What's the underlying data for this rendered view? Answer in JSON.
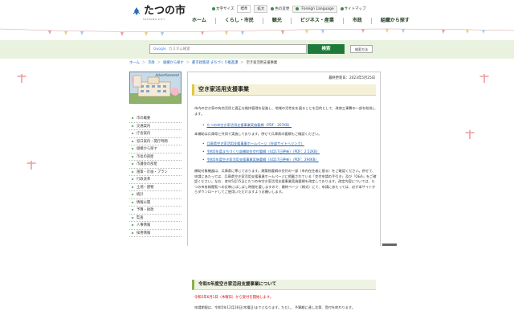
{
  "header": {
    "logo_name": "たつの市",
    "logo_sub": "TATSUNO CITY",
    "utility": {
      "font_size_label": "文字サイズ",
      "font_sizes": [
        "標準",
        "拡大"
      ],
      "lang_label": "Foreign Language",
      "sitemap_label": "サイトマップ",
      "color_label": "色の変更"
    },
    "nav": [
      "ホーム",
      "くらし・市民",
      "観光",
      "ビジネス・産業",
      "市政",
      "組織から探す"
    ]
  },
  "search": {
    "google_label": "Google",
    "placeholder": "カスタム検索",
    "button_label": "検索",
    "detail_label": "検索方法"
  },
  "breadcrumb": [
    "ホーム",
    "市政",
    "組織から探す",
    "都市政策部 まちづくり推進課",
    "空き家活用支援事業"
  ],
  "sidebar": {
    "banner_label": "Advertisement",
    "items": [
      "市の概要",
      "交通案内",
      "庁舎案内",
      "窓口案内・開庁時間",
      "組織から探す",
      "市長の部屋",
      "市議会の部屋",
      "施策・計画・プラン",
      "行政改革",
      "土地・建物",
      "統計",
      "情報公開",
      "予算・財政",
      "監査",
      "人事情報",
      "採用情報"
    ]
  },
  "main": {
    "updated": "最終更新日：2023年5月25日",
    "title": "空き家活用支援事業",
    "intro": "市内の空き家の有効活用と適正な維持管理を促進し、地域の活性化を図ることを目的として、改修工事費の一部を助成します。",
    "links1": [
      "たつの市空き家活用支援事業実施要綱（PDF：207KB）"
    ],
    "note1": "本補助は兵庫県と共同で実施しております。併せて兵庫県の要綱もご確認ください。",
    "links2": [
      "兵庫県空き家活用支援事業ホームページ（外部サイトへリンク）",
      "令和5年度まちづくり部補助金交付要綱（4月17日更新）（PDF：2.52KB）",
      "令和5年度空き家活用支援事業実施要綱（4月17日更新）（PDF：294KB）"
    ],
    "body2": "補助対象機器は、兵庫県に準じております。建築物要綱の交付の一部（市内在住者に限る）をご確認ください。併せて、申請にあたっては、兵庫県空き家活用支援事業ホームページに掲載されている「交付申請の手引き」及び「Q&A」をご確認ください。なお、本年5月15日にたつの市空き家活用支援事業実施要綱を改定しております。改定内容については、たつの市各検閲覧への反映にはしばし時間を要しますので、最終ページ（様式）にて、申請にあたっては、必ず本サイトからダウンロードしてご使用いただけますようお願いします。",
    "section_title": "令和5年度空き家活用支援事業について",
    "red_text": "令和5年6月1日（木曜日）から受付を開始します。",
    "footer_text": "申請期限は、令和5年12月28日(木曜日)までとなります。ただし、予算額に達し次第、受付を終わります。"
  },
  "colors": {
    "accent_green": "#1e7a3a",
    "title_band": "#f4f1d8",
    "section_band": "#eef3e3",
    "search_band": "#e9f2df",
    "alert_red": "#dd0000"
  }
}
